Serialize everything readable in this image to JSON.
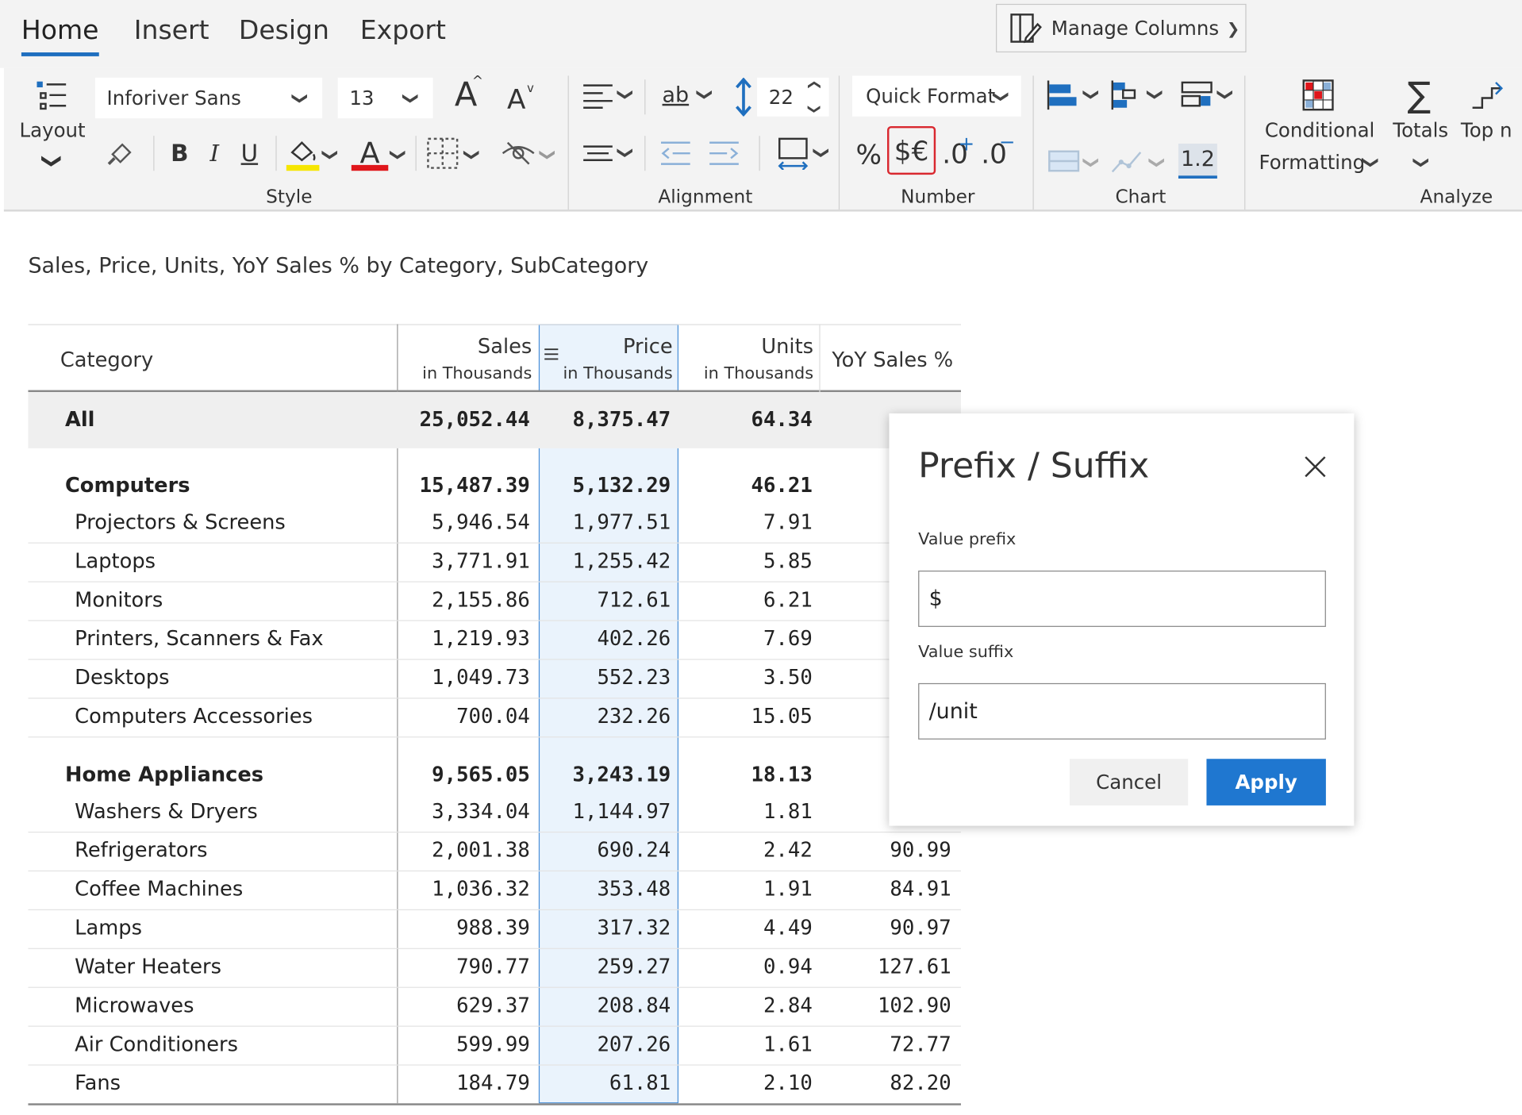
{
  "tabs": [
    "Home",
    "Insert",
    "Design",
    "Export"
  ],
  "manage_columns": "Manage Columns",
  "ribbon": {
    "layout_label": "Layout",
    "font_name": "Inforiver Sans",
    "font_size": "13",
    "bold": "B",
    "italic": "I",
    "underline": "U",
    "font_color_glyph": "A",
    "grow_font_glyph": "A",
    "shrink_font_glyph": "A",
    "line_height": "22",
    "wrap_glyph": "ab",
    "quick_format": "Quick Format",
    "percent_glyph": "%",
    "currency_glyph": "$€",
    "decimal_increase": ".0",
    "decimal_decrease": ".0",
    "decimal_sample": "1.2",
    "conditional_formatting_1": "Conditional",
    "conditional_formatting_2": "Formatting",
    "totals": "Totals",
    "topn": "Top n",
    "groups": {
      "style": "Style",
      "alignment": "Alignment",
      "number": "Number",
      "chart": "Chart",
      "analyze": "Analyze"
    }
  },
  "report_title": "Sales, Price, Units, YoY Sales % by Category, SubCategory",
  "table": {
    "columns": [
      {
        "title": "Category",
        "sub": ""
      },
      {
        "title": "Sales",
        "sub": "in Thousands"
      },
      {
        "title": "Price",
        "sub": "in Thousands"
      },
      {
        "title": "Units",
        "sub": "in Thousands"
      },
      {
        "title": "YoY Sales %",
        "sub": ""
      }
    ],
    "rows": [
      {
        "category": "All",
        "sales": "25,052.44",
        "price": "8,375.47",
        "units": "64.34",
        "yoy": "",
        "type": "total"
      },
      {
        "category": "Computers",
        "sales": "15,487.39",
        "price": "5,132.29",
        "units": "46.21",
        "yoy": "",
        "type": "group"
      },
      {
        "category": "Projectors & Screens",
        "sales": "5,946.54",
        "price": "1,977.51",
        "units": "7.91",
        "yoy": "",
        "type": "sub"
      },
      {
        "category": "Laptops",
        "sales": "3,771.91",
        "price": "1,255.42",
        "units": "5.85",
        "yoy": "",
        "type": "sub"
      },
      {
        "category": "Monitors",
        "sales": "2,155.86",
        "price": "712.61",
        "units": "6.21",
        "yoy": "",
        "type": "sub"
      },
      {
        "category": "Printers, Scanners & Fax",
        "sales": "1,219.93",
        "price": "402.26",
        "units": "7.69",
        "yoy": "",
        "type": "sub"
      },
      {
        "category": "Desktops",
        "sales": "1,049.73",
        "price": "552.23",
        "units": "3.50",
        "yoy": "",
        "type": "sub"
      },
      {
        "category": "Computers Accessories",
        "sales": "700.04",
        "price": "232.26",
        "units": "15.05",
        "yoy": "",
        "type": "sub"
      },
      {
        "category": "Home Appliances",
        "sales": "9,565.05",
        "price": "3,243.19",
        "units": "18.13",
        "yoy": "",
        "type": "group"
      },
      {
        "category": "Washers & Dryers",
        "sales": "3,334.04",
        "price": "1,144.97",
        "units": "1.81",
        "yoy": "",
        "type": "sub"
      },
      {
        "category": "Refrigerators",
        "sales": "2,001.38",
        "price": "690.24",
        "units": "2.42",
        "yoy": "90.99",
        "type": "sub"
      },
      {
        "category": "Coffee Machines",
        "sales": "1,036.32",
        "price": "353.48",
        "units": "1.91",
        "yoy": "84.91",
        "type": "sub"
      },
      {
        "category": "Lamps",
        "sales": "988.39",
        "price": "317.32",
        "units": "4.49",
        "yoy": "90.97",
        "type": "sub"
      },
      {
        "category": "Water Heaters",
        "sales": "790.77",
        "price": "259.27",
        "units": "0.94",
        "yoy": "127.61",
        "type": "sub"
      },
      {
        "category": "Microwaves",
        "sales": "629.37",
        "price": "208.84",
        "units": "2.84",
        "yoy": "102.90",
        "type": "sub"
      },
      {
        "category": "Air Conditioners",
        "sales": "599.99",
        "price": "207.26",
        "units": "1.61",
        "yoy": "72.77",
        "type": "sub"
      },
      {
        "category": "Fans",
        "sales": "184.79",
        "price": "61.81",
        "units": "2.10",
        "yoy": "82.20",
        "type": "sub"
      }
    ]
  },
  "dialog": {
    "title": "Prefix / Suffix",
    "prefix_label": "Value prefix",
    "prefix_value": "$",
    "suffix_label": "Value suffix",
    "suffix_value": "/unit",
    "cancel": "Cancel",
    "apply": "Apply"
  },
  "colors": {
    "accent": "#1f6fbf",
    "apply_button": "#1f77d0",
    "highlight_border": "#d9282f",
    "price_column_bg": "#eaf3fc"
  }
}
